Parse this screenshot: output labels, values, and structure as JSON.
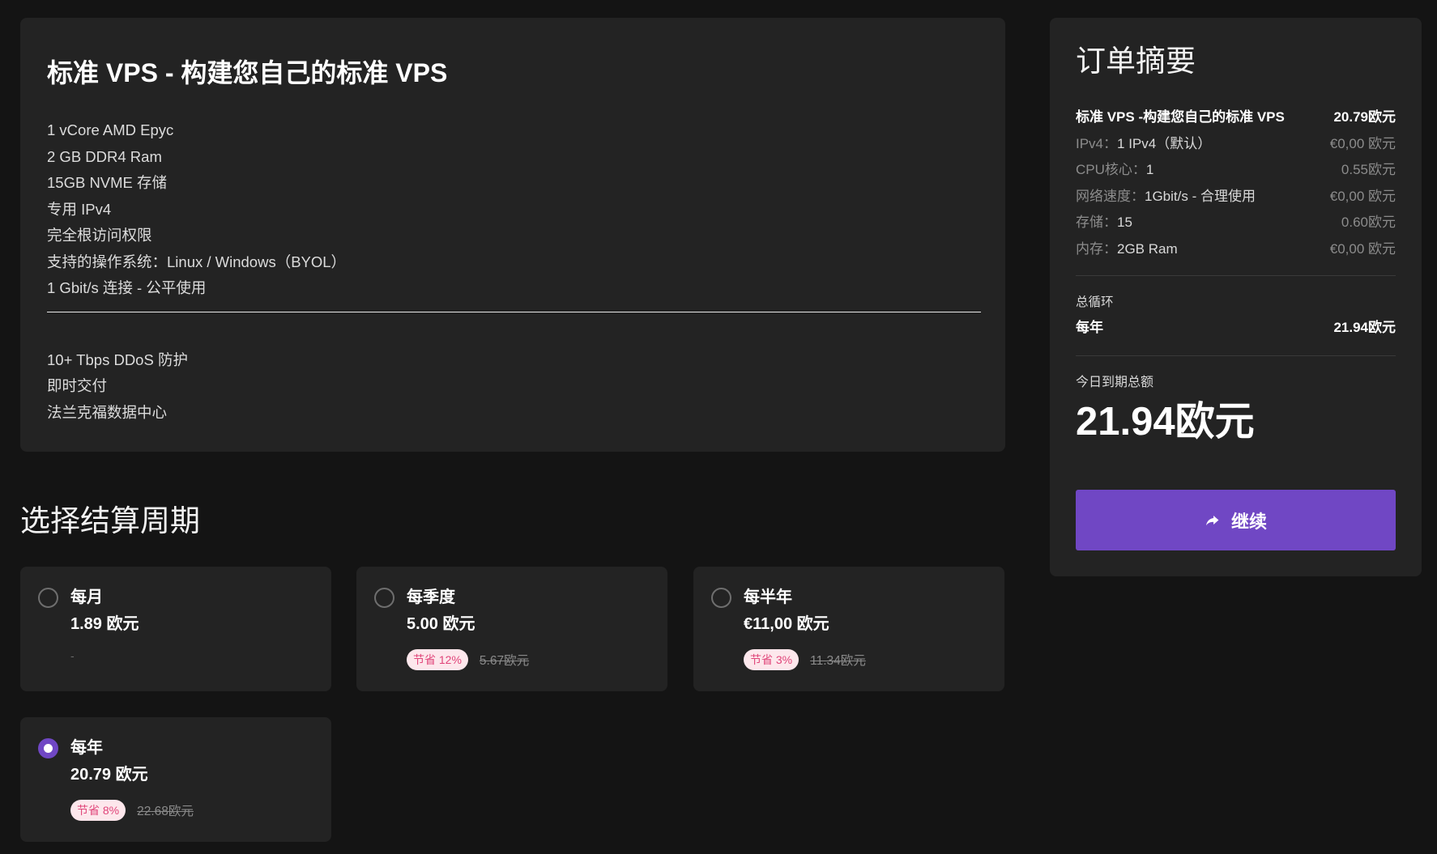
{
  "product": {
    "title": "标准 VPS - 构建您自己的标准 VPS",
    "features_main": [
      "1 vCore AMD Epyc",
      "2 GB DDR4 Ram",
      "15GB NVME 存储",
      "专用 IPv4",
      "完全根访问权限",
      "支持的操作系统：Linux / Windows（BYOL）",
      "1 Gbit/s 连接 - 公平使用"
    ],
    "features_extra": [
      "10+ Tbps DDoS 防护",
      "即时交付",
      "法兰克福数据中心"
    ]
  },
  "billing": {
    "heading": "选择结算周期",
    "options": [
      {
        "name": "每月",
        "price": "1.89 欧元",
        "badge": "",
        "old_price": "",
        "placeholder": "-",
        "selected": false
      },
      {
        "name": "每季度",
        "price": "5.00 欧元",
        "badge": "节省 12%",
        "old_price": "5.67欧元",
        "placeholder": "",
        "selected": false
      },
      {
        "name": "每半年",
        "price": "€11,00 欧元",
        "badge": "节省 3%",
        "old_price": "11.34欧元",
        "placeholder": "",
        "selected": false
      },
      {
        "name": "每年",
        "price": "20.79 欧元",
        "badge": "节省 8%",
        "old_price": "22.68欧元",
        "placeholder": "",
        "selected": true
      }
    ]
  },
  "summary": {
    "title": "订单摘要",
    "product_name": "标准 VPS -构建您自己的标准 VPS",
    "product_price": "20.79欧元",
    "items": [
      {
        "key": "IPv4：",
        "value": "1 IPv4（默认）",
        "price": "€0,00 欧元"
      },
      {
        "key": "CPU核心：",
        "value": "1",
        "price": "0.55欧元"
      },
      {
        "key": "网络速度：",
        "value": "1Gbit/s - 合理使用",
        "price": "€0,00 欧元"
      },
      {
        "key": "存储：",
        "value": "15",
        "price": "0.60欧元"
      },
      {
        "key": "内存：",
        "value": "2GB Ram",
        "price": "€0,00 欧元"
      }
    ],
    "recurring_label": "总循环",
    "recurring_period": "每年",
    "recurring_amount": "21.94欧元",
    "due_today_label": "今日到期总额",
    "due_today_amount": "21.94欧元",
    "continue_label": "继续"
  },
  "colors": {
    "background": "#141414",
    "card": "#232323",
    "accent": "#7047c4",
    "badge_bg": "#fde7ec",
    "badge_text": "#e0457a"
  },
  "icons": {
    "continue": "share-arrow-icon"
  }
}
